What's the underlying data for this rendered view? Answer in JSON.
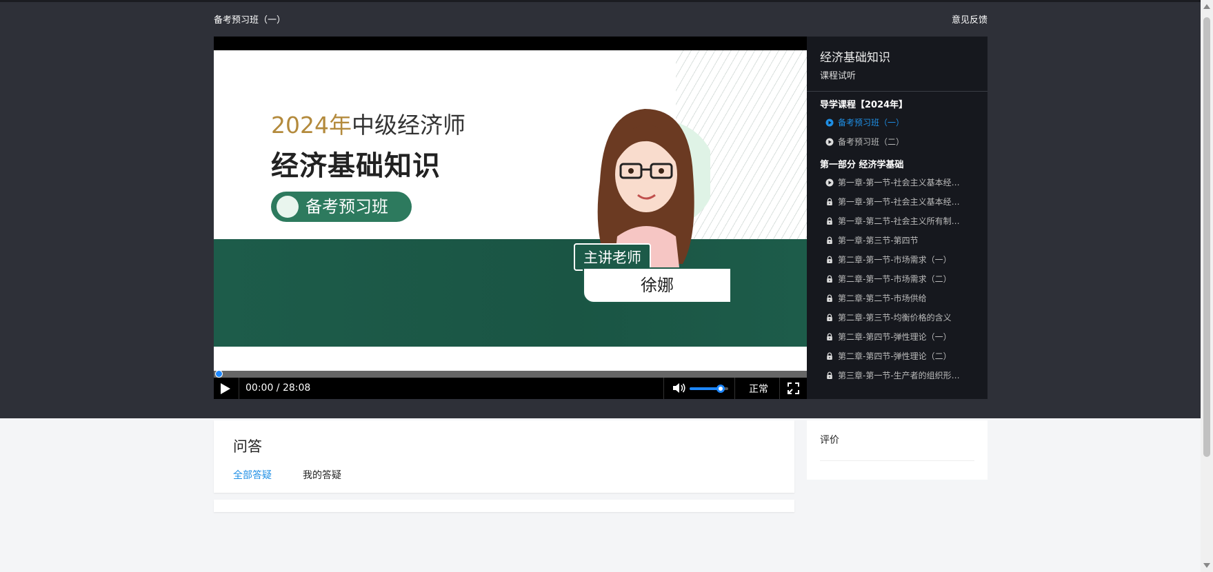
{
  "header": {
    "course_title": "备考预习班（一）",
    "feedback_label": "意见反馈"
  },
  "video": {
    "slide": {
      "year_text": "2024年",
      "exam_text": "中级经济师",
      "subject_text": "经济基础知识",
      "badge_text": "备考预习班",
      "teacher_tag": "主讲老师",
      "teacher_name": "徐娜"
    },
    "controls": {
      "time": "00:00 / 28:08",
      "speed_label": "正常",
      "progress_fraction": 0.0,
      "volume_fraction": 0.8
    }
  },
  "catalog": {
    "title": "经济基础知识",
    "subtitle": "课程试听",
    "sections": [
      {
        "title": "导学课程【2024年】",
        "items": [
          {
            "label": "备考预习班（一）",
            "icon": "play-circle-icon",
            "active": true
          },
          {
            "label": "备考预习班（二）",
            "icon": "play-circle-icon",
            "active": false
          }
        ]
      },
      {
        "title": "第一部分 经济学基础",
        "items": [
          {
            "label": "第一章-第一节-社会主义基本经济...",
            "icon": "play-circle-icon",
            "active": false
          },
          {
            "label": "第一章-第一节-社会主义基本经济...",
            "icon": "lock-icon",
            "active": false
          },
          {
            "label": "第一章-第二节-社会主义所有制结...",
            "icon": "lock-icon",
            "active": false
          },
          {
            "label": "第一章-第三节-第四节",
            "icon": "lock-icon",
            "active": false
          },
          {
            "label": "第二章-第一节-市场需求（一）",
            "icon": "lock-icon",
            "active": false
          },
          {
            "label": "第二章-第一节-市场需求（二）",
            "icon": "lock-icon",
            "active": false
          },
          {
            "label": "第二章-第二节-市场供给",
            "icon": "lock-icon",
            "active": false
          },
          {
            "label": "第二章-第三节-均衡价格的含义",
            "icon": "lock-icon",
            "active": false
          },
          {
            "label": "第二章-第四节-弹性理论（一）",
            "icon": "lock-icon",
            "active": false
          },
          {
            "label": "第二章-第四节-弹性理论（二）",
            "icon": "lock-icon",
            "active": false
          },
          {
            "label": "第三章-第一节-生产者的组织形式...",
            "icon": "lock-icon",
            "active": false
          }
        ]
      }
    ]
  },
  "qa": {
    "title": "问答",
    "tabs": [
      {
        "label": "全部答疑",
        "active": true
      },
      {
        "label": "我的答疑",
        "active": false
      }
    ]
  },
  "rating": {
    "title": "评价"
  },
  "colors": {
    "accent": "#1f8fe5",
    "dark_band": "#2e3038",
    "catalog_bg": "#16181e",
    "slide_green": "#1d5c4a",
    "slide_gold": "#b38a3c"
  }
}
